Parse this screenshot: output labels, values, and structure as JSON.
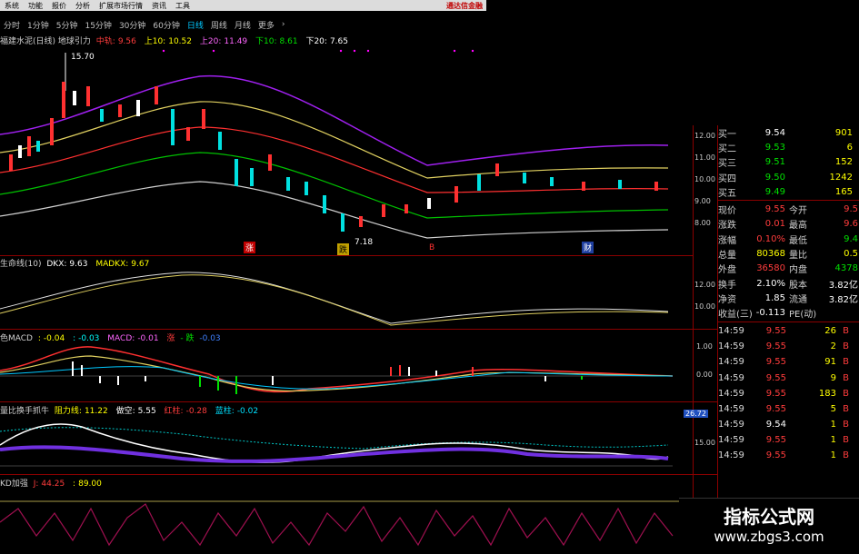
{
  "menu": {
    "items": [
      "系统",
      "功能",
      "报价",
      "分析",
      "扩展市场行情",
      "资讯",
      "工具"
    ],
    "brand": "通达信金融"
  },
  "periods": {
    "items": [
      "分时",
      "1分钟",
      "5分钟",
      "15分钟",
      "30分钟",
      "60分钟",
      "日线",
      "周线",
      "月线",
      "更多"
    ],
    "active": 6,
    "more_arrow": "›"
  },
  "main_panel": {
    "title": "福建水泥(日线) 地球引力",
    "params": [
      {
        "label": "中轨:",
        "value": "9.56",
        "color": "#ff3c3c"
      },
      {
        "label": "上10:",
        "value": "10.52",
        "color": "#ffff00"
      },
      {
        "label": "上20:",
        "value": "11.49",
        "color": "#ff66ff"
      },
      {
        "label": "下10:",
        "value": "8.61",
        "color": "#00e000"
      },
      {
        "label": "下20:",
        "value": "7.65",
        "color": "#ffffff"
      }
    ],
    "high_mark": "15.70",
    "low_mark": "7.18",
    "y_ticks": [
      "12.00",
      "11.00",
      "10.00",
      "9.00",
      "8.00"
    ],
    "event_tags": [
      "涨",
      "跌",
      "B",
      "财"
    ]
  },
  "dkx_panel": {
    "title": "生命线(10)",
    "params": [
      {
        "label": "DKX:",
        "value": "9.63",
        "color": "#ffffff"
      },
      {
        "label": "MADKX:",
        "value": "9.67",
        "color": "#ffff00"
      }
    ],
    "y_ticks": [
      "12.00",
      "10.00"
    ]
  },
  "macd_panel": {
    "title": "色MACD",
    "params": [
      {
        "label": ":",
        "value": "-0.04",
        "color": "#ffff00"
      },
      {
        "label": ":",
        "value": "-0.03",
        "color": "#00ffff"
      },
      {
        "label": "MACD:",
        "value": "-0.01",
        "color": "#ff66ff"
      },
      {
        "label": "",
        "value": "涨",
        "color": "#ff3c3c"
      },
      {
        "label": "",
        "value": "- 跌",
        "color": "#00e000"
      },
      {
        "label": "",
        "value": "-0.03",
        "color": "#4080ff"
      }
    ],
    "y_ticks": [
      "1.00",
      "0.00"
    ]
  },
  "vol_panel": {
    "title": "量比换手抓牛",
    "params": [
      {
        "label": "阻力线:",
        "value": "11.22",
        "color": "#ffff00"
      },
      {
        "label": "做空:",
        "value": "5.55",
        "color": "#ffffff"
      },
      {
        "label": "红柱:",
        "value": "-0.28",
        "color": "#ff3c3c"
      },
      {
        "label": "蓝柱:",
        "value": "-0.02",
        "color": "#00e0ff"
      }
    ],
    "current_box": "26.72",
    "y_ticks": [
      "15.00"
    ]
  },
  "kd_panel": {
    "title": "KD加强",
    "params": [
      {
        "label": "J:",
        "value": "44.25",
        "color": "#ff3c3c"
      },
      {
        "label": ":",
        "value": "89.00",
        "color": "#ffff00"
      }
    ]
  },
  "quote": {
    "bid_rows": [
      {
        "label": "买一",
        "price": "9.54",
        "vol": "901"
      },
      {
        "label": "买二",
        "price": "9.53",
        "vol": "6"
      },
      {
        "label": "买三",
        "price": "9.51",
        "vol": "152"
      },
      {
        "label": "买四",
        "price": "9.50",
        "vol": "1242"
      },
      {
        "label": "买五",
        "price": "9.49",
        "vol": "165"
      }
    ],
    "stats": [
      {
        "l1": "现价",
        "v1": "9.55",
        "c1": "#ff3c3c",
        "l2": "今开",
        "v2": "9.5",
        "c2": "#ff3c3c"
      },
      {
        "l1": "涨跌",
        "v1": "0.01",
        "c1": "#ff3c3c",
        "l2": "最高",
        "v2": "9.6",
        "c2": "#ff3c3c"
      },
      {
        "l1": "涨幅",
        "v1": "0.10%",
        "c1": "#ff3c3c",
        "l2": "最低",
        "v2": "9.4",
        "c2": "#00e000"
      },
      {
        "l1": "总量",
        "v1": "80368",
        "c1": "#ffff00",
        "l2": "量比",
        "v2": "0.5",
        "c2": "#ffff00"
      },
      {
        "l1": "外盘",
        "v1": "36580",
        "c1": "#ff3c3c",
        "l2": "内盘",
        "v2": "4378",
        "c2": "#00e000"
      },
      {
        "l1": "换手",
        "v1": "2.10%",
        "c1": "#ffffff",
        "l2": "股本",
        "v2": "3.82亿",
        "c2": "#ffffff"
      },
      {
        "l1": "净资",
        "v1": "1.85",
        "c1": "#ffffff",
        "l2": "流通",
        "v2": "3.82亿",
        "c2": "#ffffff"
      },
      {
        "l1": "收益(三)",
        "v1": "-0.113",
        "c1": "#ffffff",
        "l2": "PE(动)",
        "v2": "",
        "c2": "#ffffff"
      }
    ],
    "ticks": [
      {
        "time": "14:59",
        "price": "9.55",
        "vol": "26",
        "flag": "B"
      },
      {
        "time": "14:59",
        "price": "9.55",
        "vol": "2",
        "flag": "B"
      },
      {
        "time": "14:59",
        "price": "9.55",
        "vol": "91",
        "flag": "B"
      },
      {
        "time": "14:59",
        "price": "9.55",
        "vol": "9",
        "flag": "B"
      },
      {
        "time": "14:59",
        "price": "9.55",
        "vol": "183",
        "flag": "B"
      },
      {
        "time": "14:59",
        "price": "9.55",
        "vol": "5",
        "flag": "B"
      },
      {
        "time": "14:59",
        "price": "9.54",
        "vol": "1",
        "flag": "B"
      },
      {
        "time": "14:59",
        "price": "9.55",
        "vol": "1",
        "flag": "B"
      },
      {
        "time": "14:59",
        "price": "9.55",
        "vol": "1",
        "flag": "B"
      }
    ]
  },
  "watermark": {
    "line1": "指标公式网",
    "line2": "www.zbgs3.com"
  }
}
